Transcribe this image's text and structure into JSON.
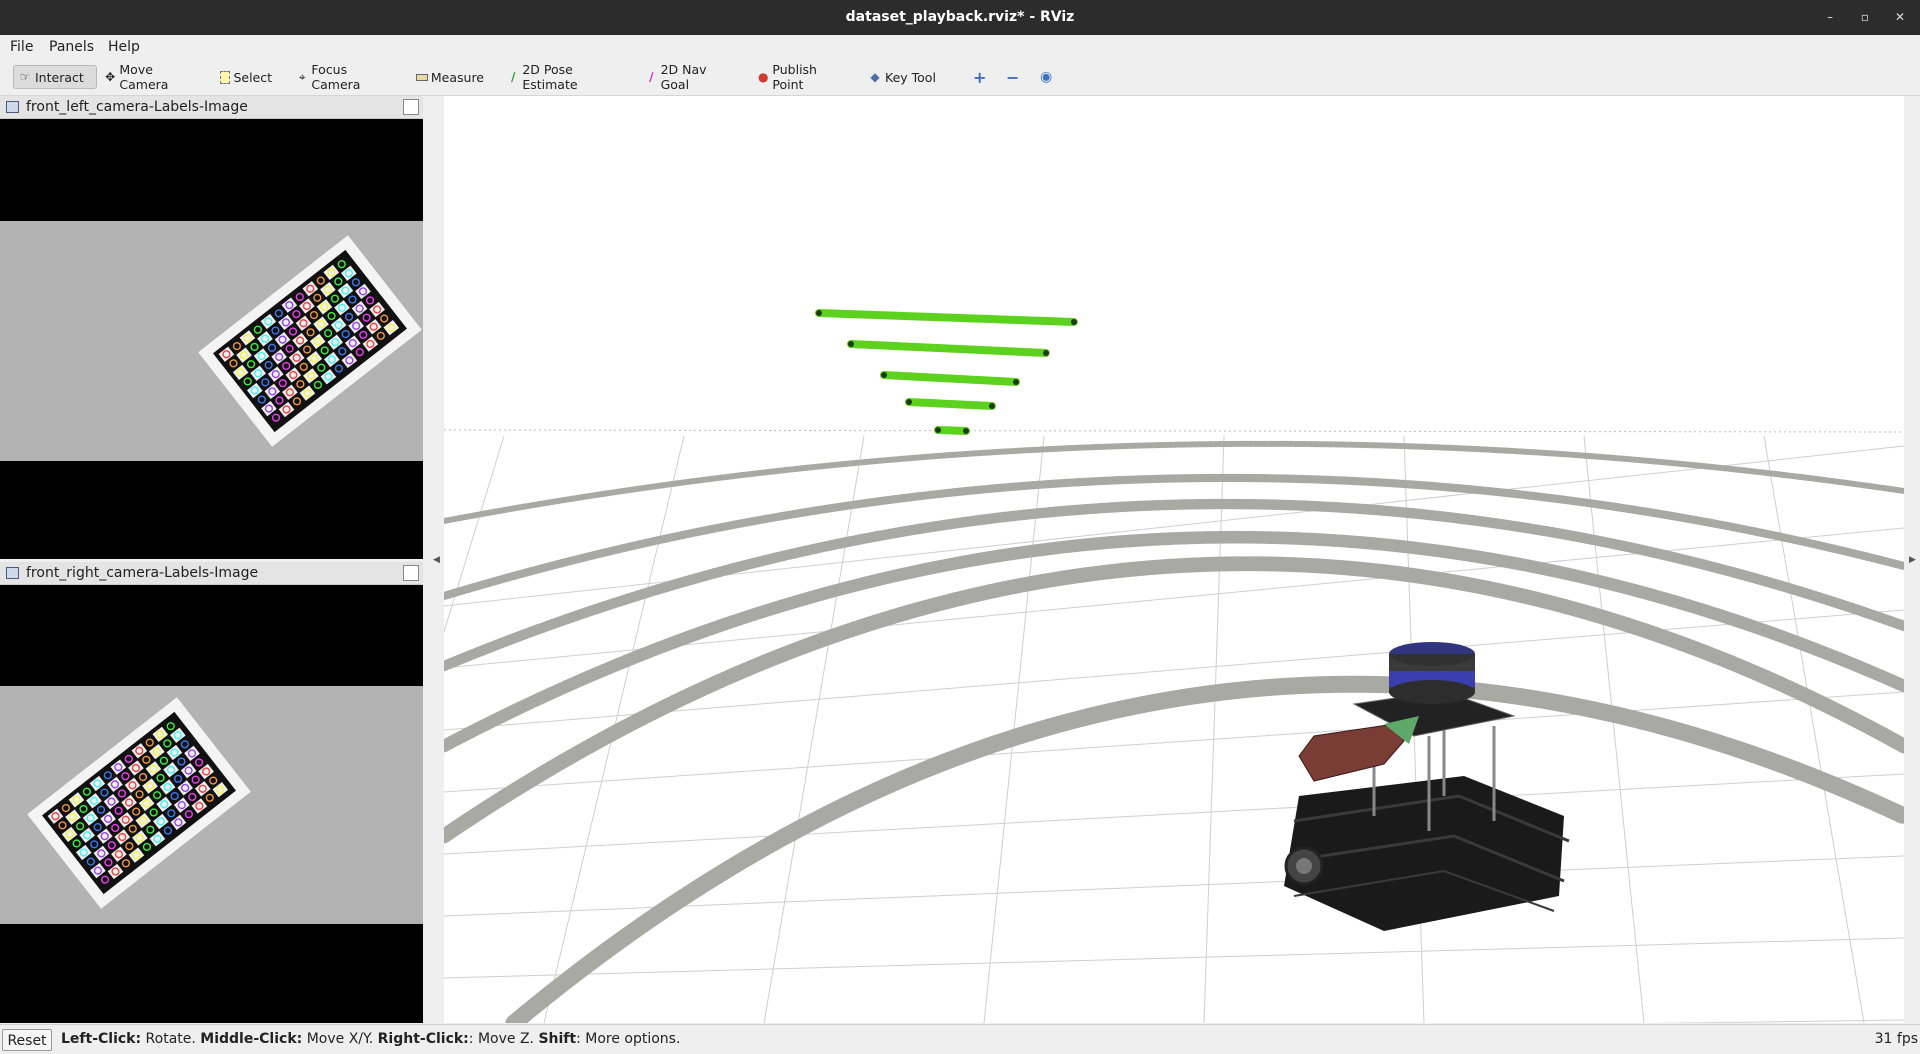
{
  "window": {
    "title": "dataset_playback.rviz* - RViz"
  },
  "menu": [
    "File",
    "Panels",
    "Help"
  ],
  "toolbar": {
    "tools": [
      {
        "label": "Interact",
        "icon": "hand-cursor-icon"
      },
      {
        "label": "Move Camera",
        "icon": "move-arrows-icon"
      },
      {
        "label": "Select",
        "icon": "select-box-icon"
      },
      {
        "label": "Focus Camera",
        "icon": "focus-target-icon"
      },
      {
        "label": "Measure",
        "icon": "ruler-icon"
      },
      {
        "label": "2D Pose Estimate",
        "icon": "green-arrow-icon"
      },
      {
        "label": "2D Nav Goal",
        "icon": "magenta-arrow-icon"
      },
      {
        "label": "Publish Point",
        "icon": "map-pin-icon"
      },
      {
        "label": "Key Tool",
        "icon": "diamond-icon"
      }
    ],
    "active_tool": "Interact"
  },
  "panels": [
    {
      "title": "front_left_camera-Labels-Image"
    },
    {
      "title": "front_right_camera-Labels-Image"
    }
  ],
  "status": {
    "reset": "Reset",
    "help_parts": [
      {
        "bold": "Left-Click:",
        "text": " Rotate. "
      },
      {
        "bold": "Middle-Click:",
        "text": " Move X/Y. "
      },
      {
        "bold": "Right-Click:",
        "text": ": Move Z. "
      },
      {
        "bold": "Shift",
        "text": ": More options."
      }
    ],
    "fps": "31 fps"
  },
  "colors": {
    "titlebar": "#2c2c2c",
    "lidar_green": "#5cd21e",
    "lidar_gray": "#a9a9a3",
    "lidar_top": "#3a3fb0"
  }
}
